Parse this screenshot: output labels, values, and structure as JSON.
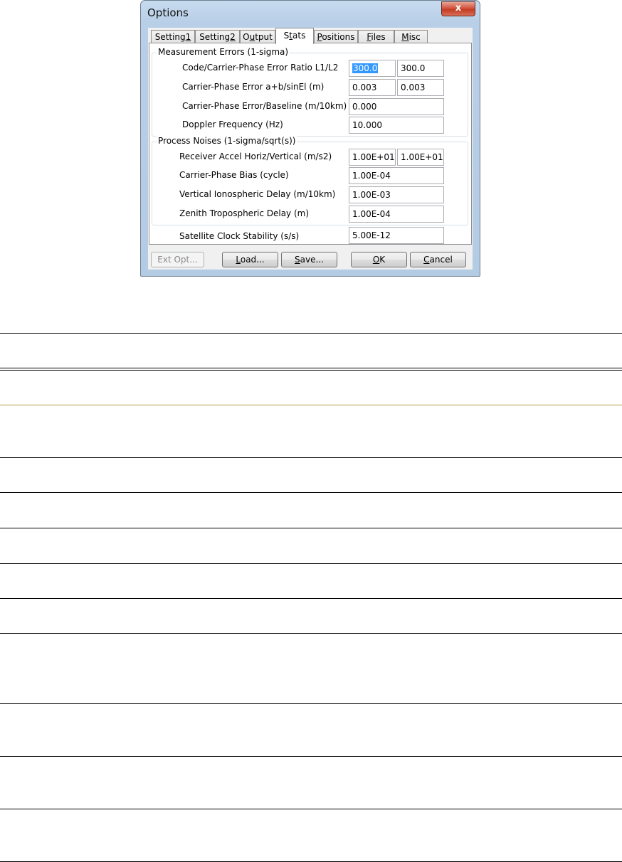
{
  "window": {
    "title": "Options",
    "close_label": "x"
  },
  "tabs": [
    {
      "pre": "Setting",
      "u": "1",
      "post": "",
      "active": false
    },
    {
      "pre": "Setting",
      "u": "2",
      "post": "",
      "active": false
    },
    {
      "pre": "O",
      "u": "u",
      "post": "tput",
      "active": false
    },
    {
      "pre": "S",
      "u": "t",
      "post": "ats",
      "active": true
    },
    {
      "pre": "",
      "u": "P",
      "post": "ositions",
      "active": false
    },
    {
      "pre": "",
      "u": "F",
      "post": "iles",
      "active": false
    },
    {
      "pre": "",
      "u": "M",
      "post": "isc",
      "active": false
    }
  ],
  "measurement": {
    "title": "Measurement Errors (1-sigma)",
    "rows": [
      {
        "label": "Code/Carrier-Phase Error Ratio L1/L2",
        "values": [
          "300.0",
          "300.0"
        ]
      },
      {
        "label": "Carrier-Phase Error a+b/sinEl (m)",
        "values": [
          "0.003",
          "0.003"
        ]
      },
      {
        "label": "Carrier-Phase Error/Baseline (m/10km)",
        "values": [
          "0.000"
        ]
      },
      {
        "label": "Doppler Frequency (Hz)",
        "values": [
          "10.000"
        ]
      }
    ]
  },
  "process": {
    "title": "Process Noises (1-sigma/sqrt(s))",
    "rows": [
      {
        "label": "Receiver Accel Horiz/Vertical (m/s2)",
        "values": [
          "1.00E+01",
          "1.00E+01"
        ]
      },
      {
        "label": "Carrier-Phase Bias (cycle)",
        "values": [
          "1.00E-04"
        ]
      },
      {
        "label": "Vertical Ionospheric Delay (m/10km)",
        "values": [
          "1.00E-03"
        ]
      },
      {
        "label": "Zenith Tropospheric Delay (m)",
        "values": [
          "1.00E-04"
        ]
      }
    ]
  },
  "clock": {
    "label": "Satellite Clock Stability (s/s)",
    "value": "5.00E-12"
  },
  "buttons": {
    "ext_opt": "Ext Opt...",
    "load": {
      "u": "L",
      "rest": "oad..."
    },
    "save": {
      "u": "S",
      "rest": "ave..."
    },
    "ok": {
      "u": "O",
      "rest": "K"
    },
    "cancel": {
      "u": "C",
      "rest": "ancel"
    }
  }
}
